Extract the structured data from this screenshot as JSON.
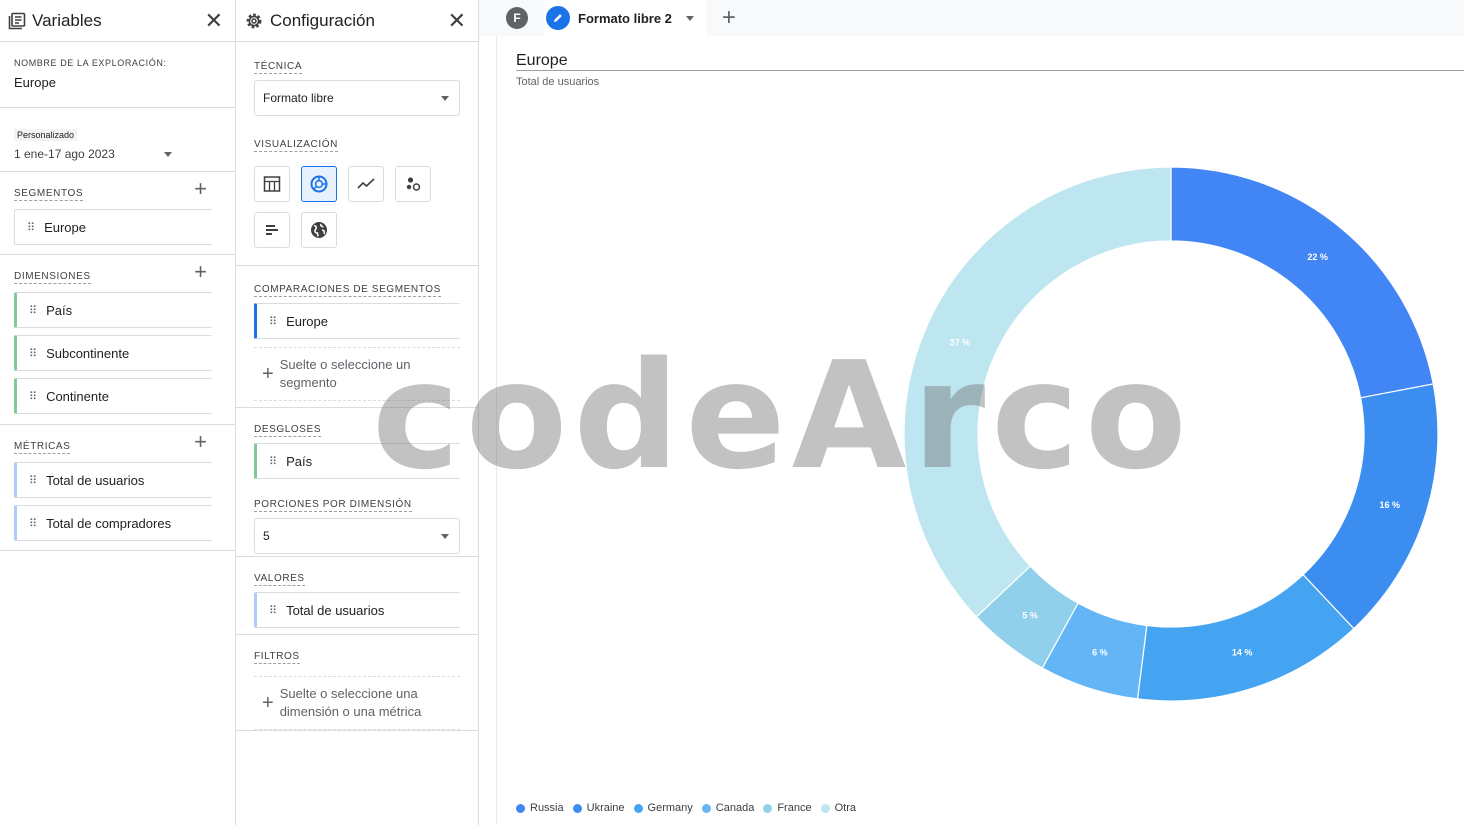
{
  "variables": {
    "title": "Variables",
    "exploration_label": "NOMBRE DE LA EXPLORACIÓN:",
    "exploration_name": "Europe",
    "date_badge": "Personalizado",
    "date_range": "1 ene-17 ago 2023",
    "segments_label": "SEGMENTOS",
    "segments": [
      "Europe"
    ],
    "dimensions_label": "DIMENSIONES",
    "dimensions": [
      "País",
      "Subcontinente",
      "Continente"
    ],
    "metrics_label": "MÉTRICAS",
    "metrics": [
      "Total de usuarios",
      "Total de compradores"
    ]
  },
  "config": {
    "title": "Configuración",
    "technique_label": "TÉCNICA",
    "technique_value": "Formato libre",
    "viz_label": "VISUALIZACIÓN",
    "viz_icons": [
      "table-icon",
      "donut-icon",
      "line-chart-icon",
      "scatter-icon",
      "bar-chart-icon",
      "globe-icon"
    ],
    "seg_comp_label": "COMPARACIONES DE SEGMENTOS",
    "seg_comp_item": "Europe",
    "seg_drop": "Suelte o seleccione un segmento",
    "breakdown_label": "DESGLOSES",
    "breakdown_item": "País",
    "rows_label": "PORCIONES POR DIMENSIÓN",
    "rows_value": "5",
    "values_label": "VALORES",
    "values_item": "Total de usuarios",
    "filters_label": "FILTROS",
    "filters_drop": "Suelte o seleccione una dimensión o una métrica"
  },
  "tabs": {
    "avatar_letter": "F",
    "active_tab": "Formato libre 2"
  },
  "watermark": "codeArco",
  "colors": {
    "accent": "#1a73e8"
  },
  "chart_data": {
    "type": "pie",
    "title": "Europe",
    "subtitle": "Total de usuarios",
    "categories": [
      "Russia",
      "Ukraine",
      "Germany",
      "Canada",
      "France",
      "Otra"
    ],
    "values": [
      22,
      16,
      14,
      6,
      5,
      37
    ],
    "labels": [
      "22 %",
      "16 %",
      "14 %",
      "6 %",
      "5 %",
      "37 %"
    ],
    "colors": [
      "#4285f4",
      "#3b8ef0",
      "#44a4f2",
      "#64b5f6",
      "#90d0ea",
      "#bde6f0"
    ],
    "legend_position": "bottom-left"
  }
}
